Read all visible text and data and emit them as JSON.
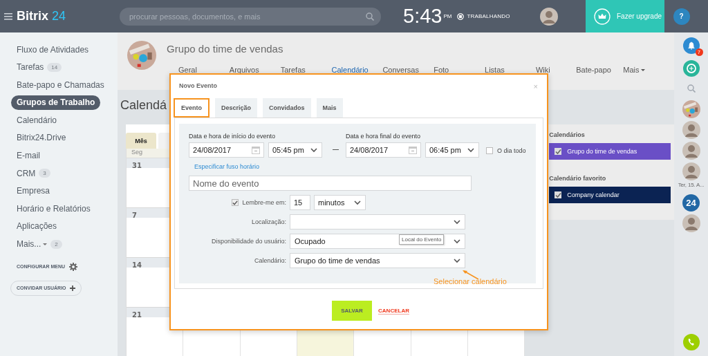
{
  "header": {
    "logo": {
      "name": "Bitrix",
      "number": "24"
    },
    "search": {
      "placeholder": "procurar pessoas, documentos, e mais"
    },
    "clock": {
      "time": "5:43",
      "suffix": "PM",
      "status": "TRABALHANDO"
    },
    "upgrade_button": "Fazer upgrade",
    "help_button": "?"
  },
  "sidebar": {
    "items": [
      {
        "label": "Fluxo de Atividades",
        "selected": false
      },
      {
        "label": "Tarefas",
        "counter": "14",
        "selected": false
      },
      {
        "label": "Bate-papo e Chamadas",
        "selected": false
      },
      {
        "label": "Grupos de Trabalho",
        "selected": true
      },
      {
        "label": "Calendário",
        "selected": false
      },
      {
        "label": "Bitrix24.Drive",
        "selected": false
      },
      {
        "label": "E-mail",
        "selected": false
      },
      {
        "label": "CRM",
        "counter": "3",
        "selected": false
      },
      {
        "label": "Empresa",
        "selected": false
      },
      {
        "label": "Horário e Relatórios",
        "selected": false
      },
      {
        "label": "Aplicações",
        "selected": false
      },
      {
        "label": "Mais...",
        "counter": "2",
        "dropdown": true,
        "selected": false
      }
    ],
    "settings_link": "CONFIGURAR MENU",
    "invite_button": "CONVIDAR USUÁRIO"
  },
  "group": {
    "title": "Grupo do time de vendas",
    "tabs": [
      {
        "label": "Geral",
        "selected": false
      },
      {
        "label": "Arquivos",
        "selected": false
      },
      {
        "label": "Tarefas",
        "selected": false
      },
      {
        "label": "Calendário",
        "selected": true
      },
      {
        "label": "Conversas",
        "selected": false
      },
      {
        "label": "Foto",
        "selected": false
      },
      {
        "label": "Listas",
        "selected": false
      },
      {
        "label": "Wiki",
        "selected": false
      },
      {
        "label": "Bate-papo",
        "selected": false
      },
      {
        "label": "Mais",
        "dropdown": true,
        "selected": false
      }
    ]
  },
  "page_title": "Calendá",
  "calendar": {
    "view_tabs": [
      {
        "label": "Mês",
        "selected": true
      }
    ],
    "weekday": "Seg",
    "week_starts": [
      "31",
      "7",
      "14",
      "21"
    ]
  },
  "calendar_list": {
    "sections": [
      {
        "title": "Calendários",
        "items": [
          {
            "name": "Grupo do time de vendas",
            "color": "#6a4fc6",
            "checked": true
          }
        ]
      },
      {
        "title": "Calendário favorito",
        "items": [
          {
            "name": "Company calendar",
            "color": "#0b2353",
            "checked": true
          }
        ]
      }
    ]
  },
  "right_bar": {
    "notification_count": "7",
    "date_label": "Ter, 15. A...",
    "app_badge": "24"
  },
  "dialog": {
    "title": "Novo Evento",
    "close": "×",
    "tabs": [
      {
        "label": "Evento",
        "selected": true
      },
      {
        "label": "Descrição",
        "selected": false
      },
      {
        "label": "Convidados",
        "selected": false
      },
      {
        "label": "Mais",
        "selected": false
      }
    ],
    "start_label": "Data e hora de início do evento",
    "start_date": "24/08/2017",
    "start_time": "05:45 pm",
    "end_label": "Data e hora final do evento",
    "end_date": "24/08/2017",
    "end_time": "06:45 pm",
    "all_day": {
      "label": "O dia todo",
      "checked": false
    },
    "timezone_link": "Especificar fuso horário",
    "name_placeholder": "Nome do evento",
    "reminder": {
      "label": "Lembre-me em:",
      "checked": true,
      "value": "15",
      "unit": "minutos"
    },
    "fields": [
      {
        "label": "Localização:"
      },
      {
        "label": "Disponibilidade do usuário:",
        "value": "Ocupado"
      },
      {
        "label": "Calendário:",
        "value": "Grupo do time de vendas"
      }
    ],
    "tooltip": "Local do Evento",
    "annotation": "Selecionar calendário",
    "save_button": "SALVAR",
    "cancel_button": "CANCELAR"
  }
}
